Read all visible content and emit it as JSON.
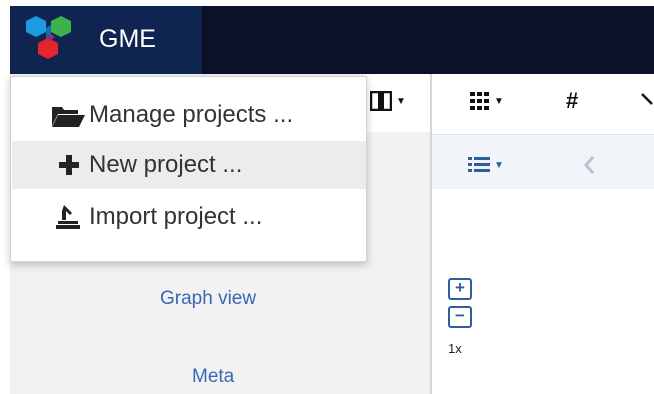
{
  "app": {
    "title": "GME",
    "logo": "gme-hexagon-logo",
    "colors": {
      "brand_blue": "#102451",
      "navbar_dark": "#0c1029",
      "link_blue": "#3967b5",
      "hex_blue": "#1e9be0",
      "hex_green": "#3db24b",
      "hex_red": "#e3262e"
    }
  },
  "menu": {
    "items": [
      {
        "label": "Manage projects ...",
        "icon": "folder-open-icon"
      },
      {
        "label": "New project ...",
        "icon": "plus-icon"
      },
      {
        "label": "Import project ...",
        "icon": "import-icon"
      }
    ]
  },
  "toolbar": {
    "buttons": [
      {
        "icon": "columns-icon",
        "dropdown": true
      },
      {
        "icon": "grid-icon",
        "dropdown": true
      },
      {
        "icon": "hash-icon",
        "label": "#"
      }
    ],
    "sub": [
      {
        "icon": "list-icon",
        "dropdown": true
      },
      {
        "icon": "chevron-left-icon"
      }
    ]
  },
  "panel": {
    "graph_view": "Graph view",
    "meta": "Meta"
  },
  "zoom": {
    "plus": "+",
    "minus": "−",
    "level": "1x"
  }
}
